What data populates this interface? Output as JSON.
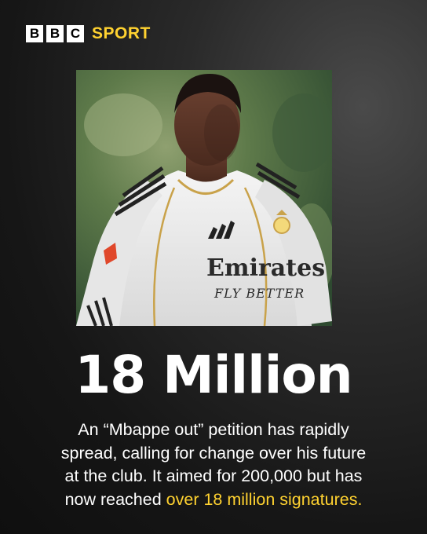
{
  "brand": {
    "letters": [
      "B",
      "B",
      "C"
    ],
    "section": "SPORT",
    "accent": "#ffd230"
  },
  "photo": {
    "shirt_sponsor_line1": "Emirates",
    "shirt_sponsor_line2": "FLY BETTER"
  },
  "headline": "18 Million",
  "body": {
    "line1": "An “Mbappe out” petition has rapidly",
    "line2": "spread, calling for change over his future",
    "line3": "at the club. It aimed for 200,000 but has",
    "line4_prefix": "now reached ",
    "line4_highlight": "over 18 million signatures."
  }
}
